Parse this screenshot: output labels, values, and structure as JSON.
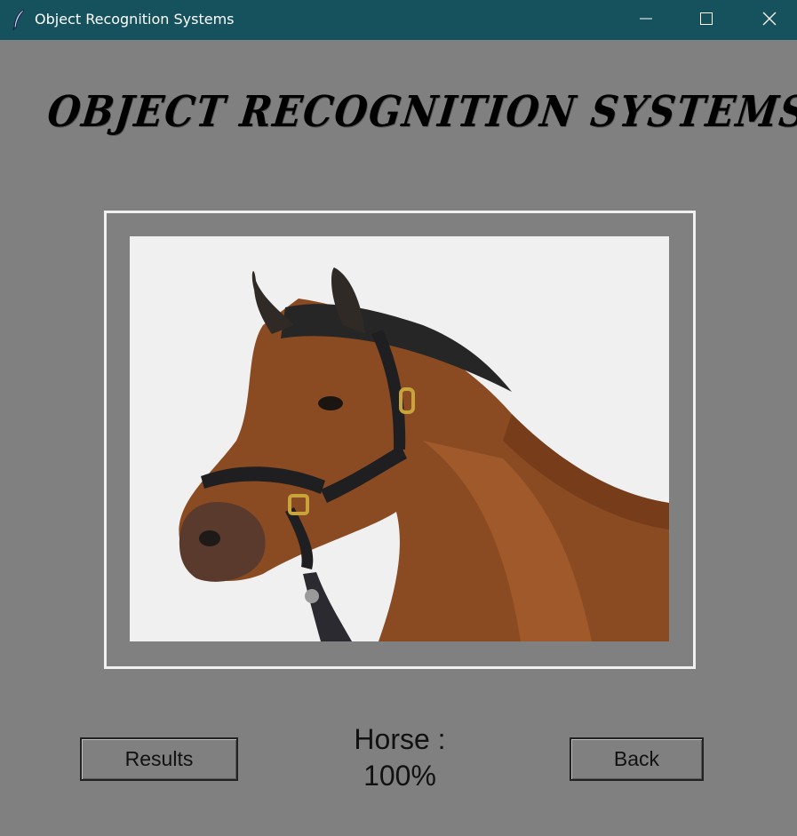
{
  "window": {
    "title": "Object Recognition Systems",
    "icons": {
      "app": "feather-icon",
      "minimize": "minimize-icon",
      "maximize": "maximize-icon",
      "close": "close-icon"
    }
  },
  "heading": "OBJECT RECOGNITION SYSTEMS",
  "image": {
    "subject": "horse"
  },
  "buttons": {
    "results": "Results",
    "back": "Back"
  },
  "result": {
    "label": "Horse :",
    "confidence": "100%"
  },
  "colors": {
    "titlebar": "#16525e",
    "background": "#808080",
    "frame": "#f0f0f0"
  }
}
